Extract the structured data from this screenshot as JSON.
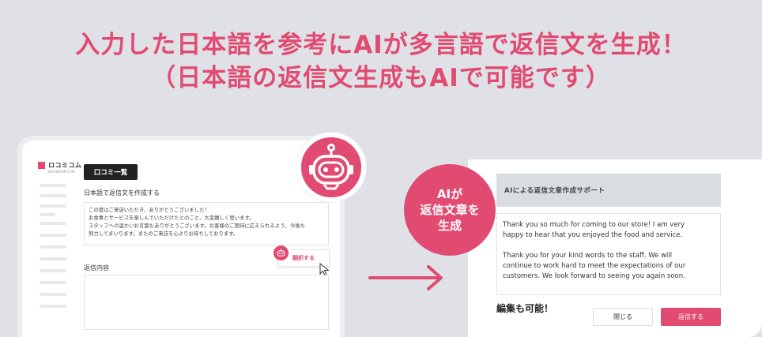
{
  "headline": {
    "line1": "入力した日本語を参考にAIが多言語で返信文を生成！",
    "line2": "（日本語の返信文生成もAIで可能です）"
  },
  "app": {
    "logo_text": "ロコミコム",
    "logo_sub": "KUCHIKOMI.COM",
    "tab_label": "口コミ一覧",
    "compose_label": "日本語で返信文を作成する",
    "review_lines": [
      "この度はご来店いただき、ありがとうございました！",
      "お食事とサービスを楽しんでいただけたとのこと、大変嬉しく思います。",
      "",
      "スタッフへの温かいお言葉もありがとうございます。お客様のご期待に応えられるよう、今後も",
      "努力してまいります。またのご来店を心よりお待ちしております。"
    ],
    "translate_label": "翻訳する",
    "reply_label": "返信内容"
  },
  "bubble": {
    "line1": "AIが",
    "line2": "返信文章を",
    "line3": "生成"
  },
  "modal": {
    "title": "AIによる返信文章作成サポート",
    "body_lines": [
      "Thank you so much for coming to our store! I am very",
      "happy to hear that you enjoyed the food and service.",
      "",
      "Thank you for your kind words to the staff. We will",
      "continue to work hard to meet the expectations of our",
      "customers. We look forward to seeing you again soon."
    ],
    "editable_note": "編集も可能！",
    "close_label": "閉じる",
    "reply_label": "返信する"
  },
  "colors": {
    "accent": "#e14b72",
    "background": "#dfe1e6"
  },
  "icons": [
    "robot-icon",
    "arrow-right-icon",
    "cursor-icon"
  ]
}
